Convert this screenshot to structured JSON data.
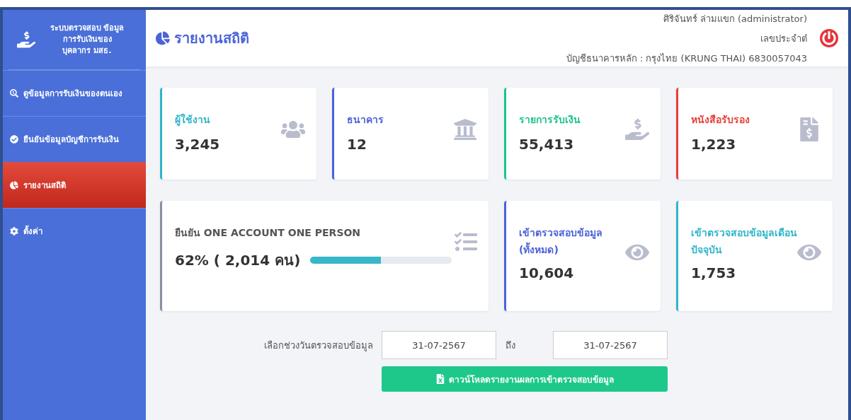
{
  "sidebar": {
    "title": "ระบบตรวจสอบ ข้อมูลการรับเงินของ บุคลากร มสธ.",
    "items": [
      {
        "kind": "search",
        "label": "ดูข้อมูลการรับเงินของตนเอง",
        "selected": false
      },
      {
        "kind": "check",
        "label": "ยืนยันข้อมูลบัญชีการรับเงิน",
        "selected": false
      },
      {
        "kind": "chart",
        "label": "รายงานสถิติ",
        "selected": true
      },
      {
        "kind": "settings",
        "label": "ตั้งค่า",
        "selected": false
      }
    ]
  },
  "header": {
    "title": "รายงานสถิติ",
    "user": "ศิริจันทร์ ล่ามแขก (administrator)",
    "id_label": "เลขประจำต๋",
    "bank": "บัญชีธนาคารหลัก : กรุงไทย (KRUNG THAI) 6830057043"
  },
  "stats": [
    {
      "kind": "users",
      "label": "ผู้ใช้งาน",
      "value": "3,245",
      "color": "#2fb5c8"
    },
    {
      "kind": "bank",
      "label": "ธนาคาร",
      "value": "12",
      "color": "#4a63d8"
    },
    {
      "kind": "money",
      "label": "รายการรับเงิน",
      "value": "55,413",
      "color": "#1ec38a"
    },
    {
      "kind": "document",
      "label": "หนังสือรับรอง",
      "value": "1,223",
      "color": "#e5413a"
    }
  ],
  "progress_card": {
    "label": "ยืนยัน ONE ACCOUNT ONE PERSON",
    "reading": "62% ( 2,014 คน)",
    "level": 0.5
  },
  "views": [
    {
      "label": "เข้าตรวจสอบข้อมูล (ทั้งหมด)",
      "value": "10,604",
      "color": "#4a63d8"
    },
    {
      "label": "เข้าตรวจสอบข้อมูลเดือนปัจจุบัน",
      "value": "1,753",
      "color": "#2fb5c8"
    }
  ],
  "report": {
    "range_label": "เลือกช่วงวันตรวจสอบข้อมูล",
    "from": "31-07-2567",
    "to_label": "ถึง",
    "to": "31-07-2567",
    "download": "ดาวน์โหลดรายงานผลการเข้าตรวจสอบข้อมูล"
  }
}
